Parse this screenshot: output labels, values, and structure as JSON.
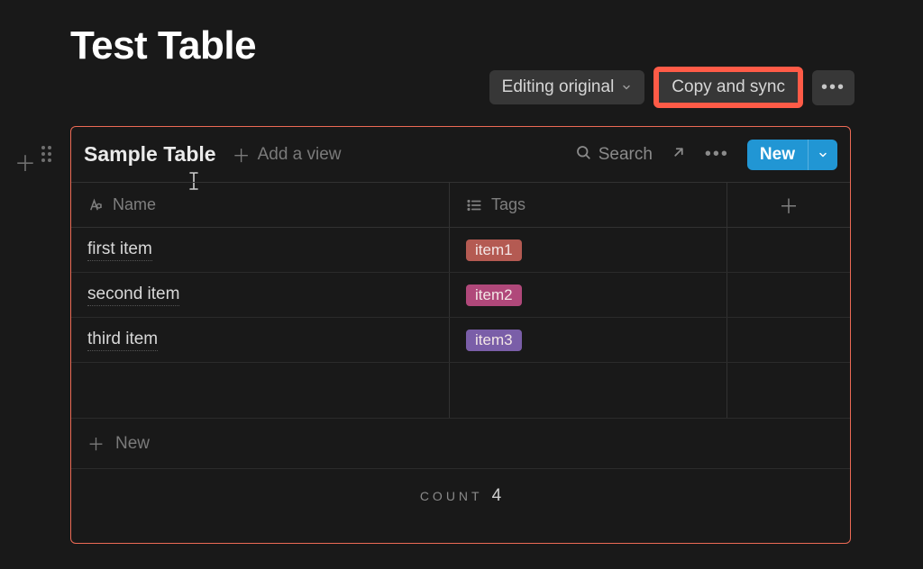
{
  "page": {
    "title": "Test Table"
  },
  "toolbar": {
    "editing_label": "Editing original",
    "copy_sync_label": "Copy and sync"
  },
  "db": {
    "title": "Sample Table",
    "add_view_label": "Add a view",
    "search_label": "Search",
    "new_button_label": "New",
    "new_row_label": "New",
    "footer": {
      "label": "Count",
      "value": "4"
    },
    "columns": {
      "name_label": "Name",
      "tags_label": "Tags"
    },
    "rows": [
      {
        "name": "first item",
        "tag": "item1",
        "tag_color": "#b45a52"
      },
      {
        "name": "second item",
        "tag": "item2",
        "tag_color": "#b0487a"
      },
      {
        "name": "third item",
        "tag": "item3",
        "tag_color": "#7a5ea8"
      }
    ]
  }
}
